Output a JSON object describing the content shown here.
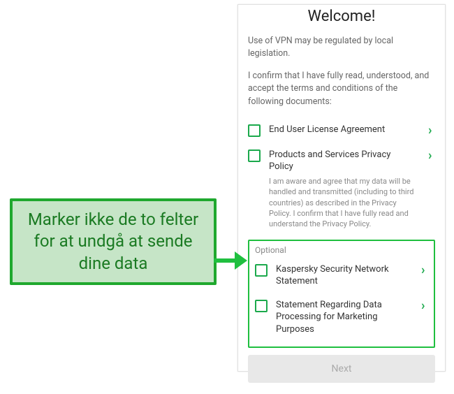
{
  "phone": {
    "title": "Welcome!",
    "regulation_text": "Use of VPN may be regulated by local legislation.",
    "confirm_text": "I confirm that I have fully read, understood, and accept the terms and conditions of the following documents:",
    "items": [
      {
        "label": "End User License Agreement"
      },
      {
        "label": "Products and Services Privacy Policy",
        "sub": "I am aware and agree that my data will be handled and transmitted (including to third countries) as described in the Privacy Policy. I confirm that I have fully read and understand the Privacy Policy."
      }
    ],
    "optional_label": "Optional",
    "optional_items": [
      {
        "label": "Kaspersky Security Network Statement"
      },
      {
        "label": "Statement Regarding Data Processing for Marketing Purposes"
      }
    ],
    "next_label": "Next"
  },
  "callout": {
    "text": "Marker ikke de to felter for at undgå at sende dine data"
  }
}
